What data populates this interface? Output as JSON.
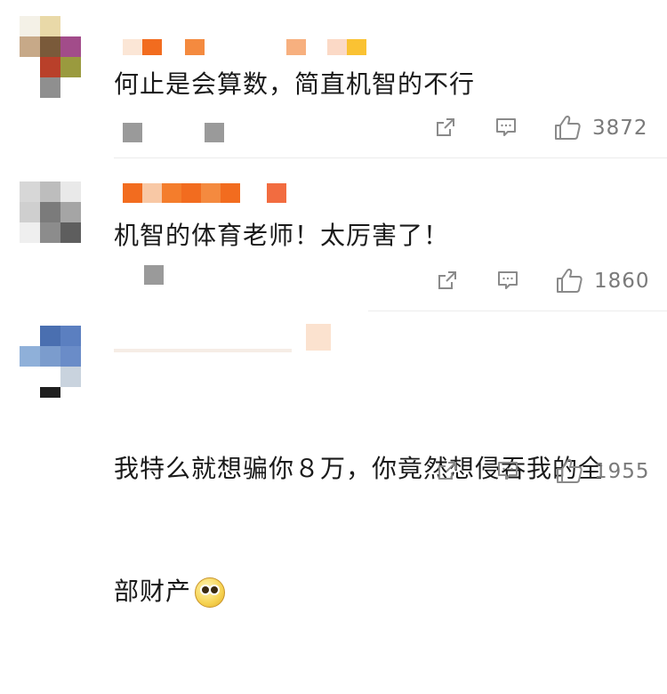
{
  "colors": {
    "text": "#1a1a1a",
    "meta": "#7a7a7a",
    "icon": "#8a8a8a",
    "divider": "#ececec",
    "username_orange": "#f26c1f"
  },
  "comments": [
    {
      "username": "",
      "text": "何止是会算数，简直机智的不行",
      "like_count": "3872",
      "icons": [
        "share-icon",
        "comment-icon",
        "thumbs-up-icon"
      ]
    },
    {
      "username": "",
      "text": "机智的体育老师！太厉害了！",
      "like_count": "1860",
      "icons": [
        "share-icon",
        "comment-icon",
        "thumbs-up-icon"
      ]
    },
    {
      "username": "",
      "text_line1": "我特么就想骗你８万，你竟然想侵吞我的全",
      "text_line2": "部财产",
      "emoji": "pleading-face-emoji",
      "like_count": "1955",
      "icons": [
        "share-icon",
        "comment-icon",
        "thumbs-up-icon"
      ]
    }
  ]
}
